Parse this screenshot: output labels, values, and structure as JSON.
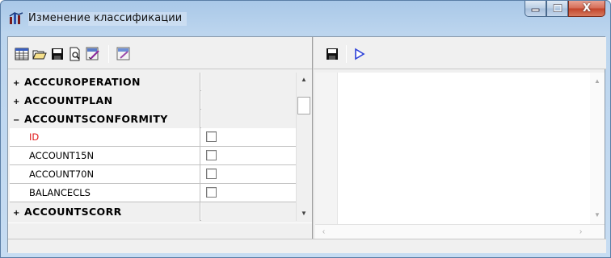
{
  "window": {
    "title": "Изменение классификации",
    "icon": "app-chart-icon",
    "controls": [
      "minimize-icon",
      "maximize-icon",
      "close-icon"
    ],
    "close_glyph": "X"
  },
  "toolbar_left": {
    "icons": [
      "grid-icon",
      "open-folder-icon",
      "save-icon",
      "preview-icon",
      "sql-edit-icon",
      "sql-icon"
    ]
  },
  "toolbar_right": {
    "icons": [
      "save-icon",
      "run-icon"
    ]
  },
  "tree": {
    "rows": [
      {
        "type": "group",
        "expander": "+",
        "label": "ACCCUROPERATION"
      },
      {
        "type": "group",
        "expander": "+",
        "label": "ACCOUNTPLAN"
      },
      {
        "type": "group",
        "expander": "−",
        "label": "ACCOUNTSCONFORMITY"
      },
      {
        "type": "field",
        "label": "ID",
        "key": true,
        "checked": false
      },
      {
        "type": "field",
        "label": "ACCOUNT15N",
        "key": false,
        "checked": false
      },
      {
        "type": "field",
        "label": "ACCOUNT70N",
        "key": false,
        "checked": false
      },
      {
        "type": "field",
        "label": "BALANCECLS",
        "key": false,
        "checked": false
      },
      {
        "type": "group",
        "expander": "+",
        "label": "ACCOUNTSCORR"
      }
    ]
  },
  "colors": {
    "key_field": "#e01818",
    "run_arrow": "#2a3fd8",
    "title_gradient": "#bcd5ee"
  }
}
